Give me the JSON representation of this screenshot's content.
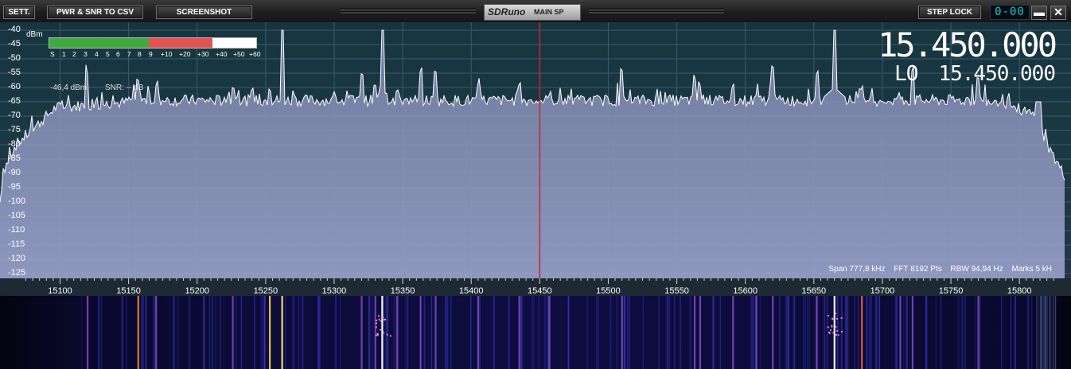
{
  "toolbar": {
    "sett_label": "SETT.",
    "csv_label": "PWR & SNR TO CSV",
    "screenshot_label": "SCREENSHOT",
    "app_name": "SDRuno",
    "window_name": "MAIN SP",
    "step_lock_label": "STEP LOCK",
    "step_digits": "0-00",
    "minimize_glyph": "▬",
    "close_glyph": "✕"
  },
  "spectrum": {
    "dbm_unit": "dBm",
    "y_ticks": [
      "-40",
      "-45",
      "-50",
      "-55",
      "-60",
      "-65",
      "-70",
      "-75",
      "-80",
      "-85",
      "-90",
      "-95",
      "-100",
      "-105",
      "-110",
      "-115",
      "-120",
      "-125"
    ],
    "s_scale": [
      "S",
      "1",
      "2",
      "3",
      "4",
      "5",
      "6",
      "7",
      "8",
      "9",
      "+10",
      "+20",
      "+30",
      "+40",
      "+50",
      "+60"
    ],
    "smeter_green_fraction": 0.48,
    "smeter_red_fraction": 0.31,
    "level_text": "-46,4 dBm",
    "snr_text": "SNR: -- dB",
    "vfo_freq": "15.450.000",
    "lo_label": "LO",
    "lo_freq": "15.450.000",
    "span_text": "Span 777,8 kHz",
    "fft_text": "FFT 8192 Pts",
    "rbw_text": "RBW 94,94 Hz",
    "marks_text": "Marks 5 kH",
    "center_marker_color": "#c62828",
    "trace_color": "#ffffff",
    "fill_color": "#9aa2cc"
  },
  "axis": {
    "x_ticks": [
      "15100",
      "15150",
      "15200",
      "15250",
      "15300",
      "15350",
      "15400",
      "15450",
      "15500",
      "15550",
      "15600",
      "15650",
      "15700",
      "15750",
      "15800"
    ]
  },
  "signals_khz": [
    15120,
    15157,
    15170,
    15226,
    15253,
    15262,
    15320,
    15330,
    15335,
    15346,
    15363,
    15374,
    15405,
    15435,
    15457,
    15510,
    15563,
    15567,
    15591,
    15608,
    15620,
    15652,
    15665,
    15685,
    15713,
    15722,
    15770
  ]
}
